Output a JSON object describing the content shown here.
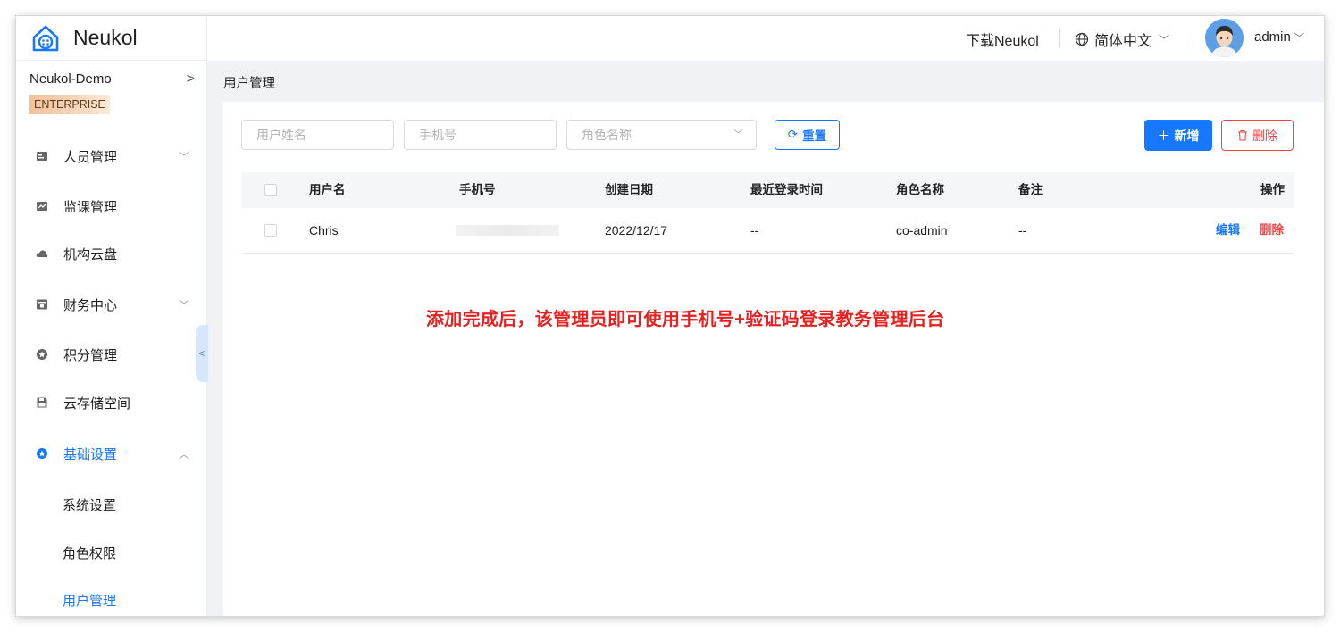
{
  "brand": {
    "name": "Neukol",
    "color": "#1677ff"
  },
  "sidebar": {
    "org_name": "Neukol-Demo",
    "org_chevron": ">",
    "edition_badge": "ENTERPRISE",
    "items": [
      {
        "label": "人员管理",
        "icon": "people-card-icon",
        "arrow": "﹀"
      },
      {
        "label": "监课管理",
        "icon": "monitor-chart-icon",
        "arrow": ""
      },
      {
        "label": "机构云盘",
        "icon": "cloud-icon",
        "arrow": ""
      },
      {
        "label": "财务中心",
        "icon": "finance-icon",
        "arrow": "﹀"
      },
      {
        "label": "积分管理",
        "icon": "points-star-icon",
        "arrow": ""
      },
      {
        "label": "云存储空间",
        "icon": "storage-disk-icon",
        "arrow": ""
      },
      {
        "label": "基础设置",
        "icon": "settings-star-icon",
        "arrow": "︿"
      }
    ],
    "sub_items": [
      "系统设置",
      "角色权限",
      "用户管理"
    ],
    "active_sub": "用户管理"
  },
  "header": {
    "download_label": "下载Neukol",
    "language_label": "简体中文",
    "user_name": "admin"
  },
  "breadcrumb": "用户管理",
  "filters": {
    "username_placeholder": "用户姓名",
    "phone_placeholder": "手机号",
    "role_placeholder": "角色名称",
    "reset_label": "重置"
  },
  "actions": {
    "add_label": "新增",
    "delete_label": "删除"
  },
  "table": {
    "columns": [
      "用户名",
      "手机号",
      "创建日期",
      "最近登录时间",
      "角色名称",
      "备注",
      "操作"
    ],
    "rows": [
      {
        "username": "Chris",
        "phone": "",
        "created": "2022/12/17",
        "last_login": "--",
        "role": "co-admin",
        "note": "--",
        "edit": "编辑",
        "delete": "删除"
      }
    ]
  },
  "annotation": "添加完成后，该管理员即可使用手机号+验证码登录教务管理后台",
  "colors": {
    "primary": "#1677ff",
    "danger": "#f04646",
    "annotation": "#e82020"
  }
}
